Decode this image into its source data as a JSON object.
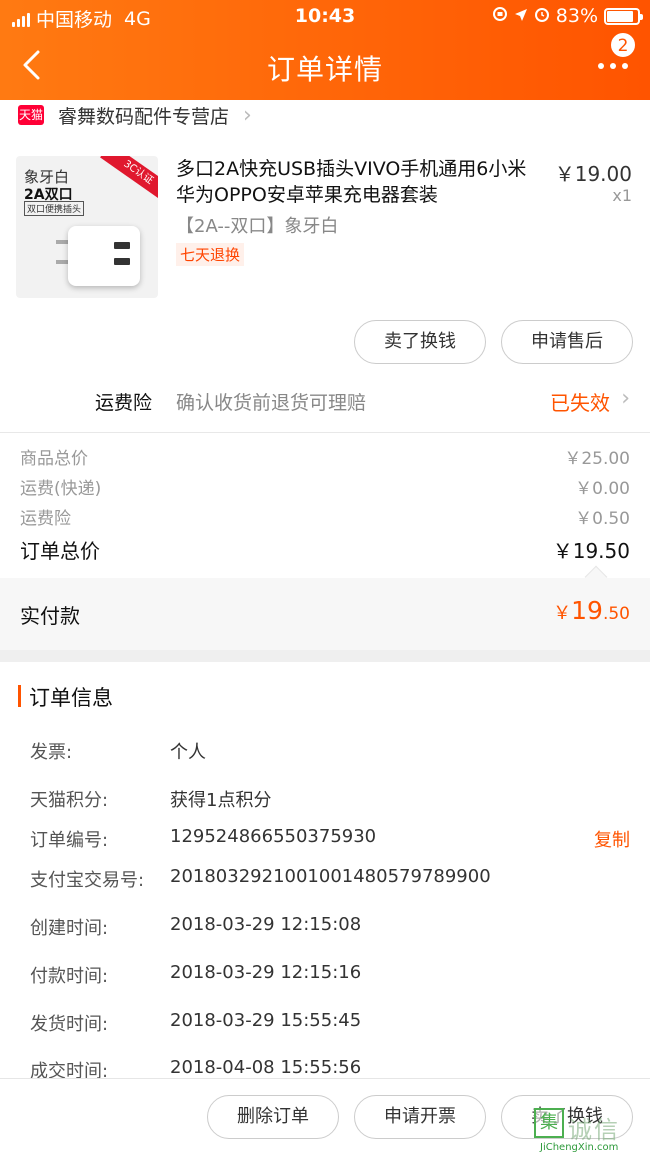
{
  "status_bar": {
    "carrier": "中国移动",
    "network": "4G",
    "time": "10:43",
    "battery": "83%"
  },
  "header": {
    "title": "订单详情",
    "badge_count": "2"
  },
  "store": {
    "tag": "天猫",
    "name": "睿舞数码配件专营店"
  },
  "product": {
    "image_caption_1": "象牙白",
    "image_caption_2": "2A双口",
    "image_caption_3": "双口便携插头",
    "image_corner": "3C认证",
    "title": "多口2A快充USB插头VIVO手机通用6小米华为OPPO安卓苹果充电器套装",
    "sku": "【2A--双口】象牙白",
    "tag": "七天退换",
    "price": "￥19.00",
    "quantity": "x1"
  },
  "product_actions": {
    "sell_label": "卖了换钱",
    "after_sale_label": "申请售后"
  },
  "insurance": {
    "label": "运费险",
    "desc": "确认收货前退货可理赔",
    "status": "已失效"
  },
  "price_summary": [
    {
      "label": "商品总价",
      "value": "￥25.00"
    },
    {
      "label": "运费(快递)",
      "value": "￥0.00"
    },
    {
      "label": "运费险",
      "value": "￥0.50"
    },
    {
      "label": "订单总价",
      "value": "￥19.50"
    }
  ],
  "payment": {
    "label": "实付款",
    "currency": "￥",
    "integer": "19",
    "decimal": ".50"
  },
  "order_info": {
    "title": "订单信息",
    "copy_label": "复制",
    "rows": [
      {
        "key": "发票:",
        "value": "个人"
      },
      {
        "key": "天猫积分:",
        "value": "获得1点积分"
      },
      {
        "key": "订单编号:",
        "value": "129524866550375930"
      },
      {
        "key": "支付宝交易号:",
        "value": "2018032921001001480579789900"
      },
      {
        "key": "创建时间:",
        "value": "2018-03-29 12:15:08"
      },
      {
        "key": "付款时间:",
        "value": "2018-03-29 12:15:16"
      },
      {
        "key": "发货时间:",
        "value": "2018-03-29 15:55:45"
      },
      {
        "key": "成交时间:",
        "value": "2018-04-08 15:55:56"
      }
    ]
  },
  "bottom_actions": {
    "delete_label": "删除订单",
    "invoice_label": "申请开票",
    "sell_label": "卖了换钱"
  },
  "watermark": {
    "logo": "集",
    "text": "诚信",
    "url": "JiChengXin.com"
  },
  "colors": {
    "brand_orange": "#ff5400",
    "tmall_red": "#ff0036",
    "watermark_green": "#4caf50"
  }
}
